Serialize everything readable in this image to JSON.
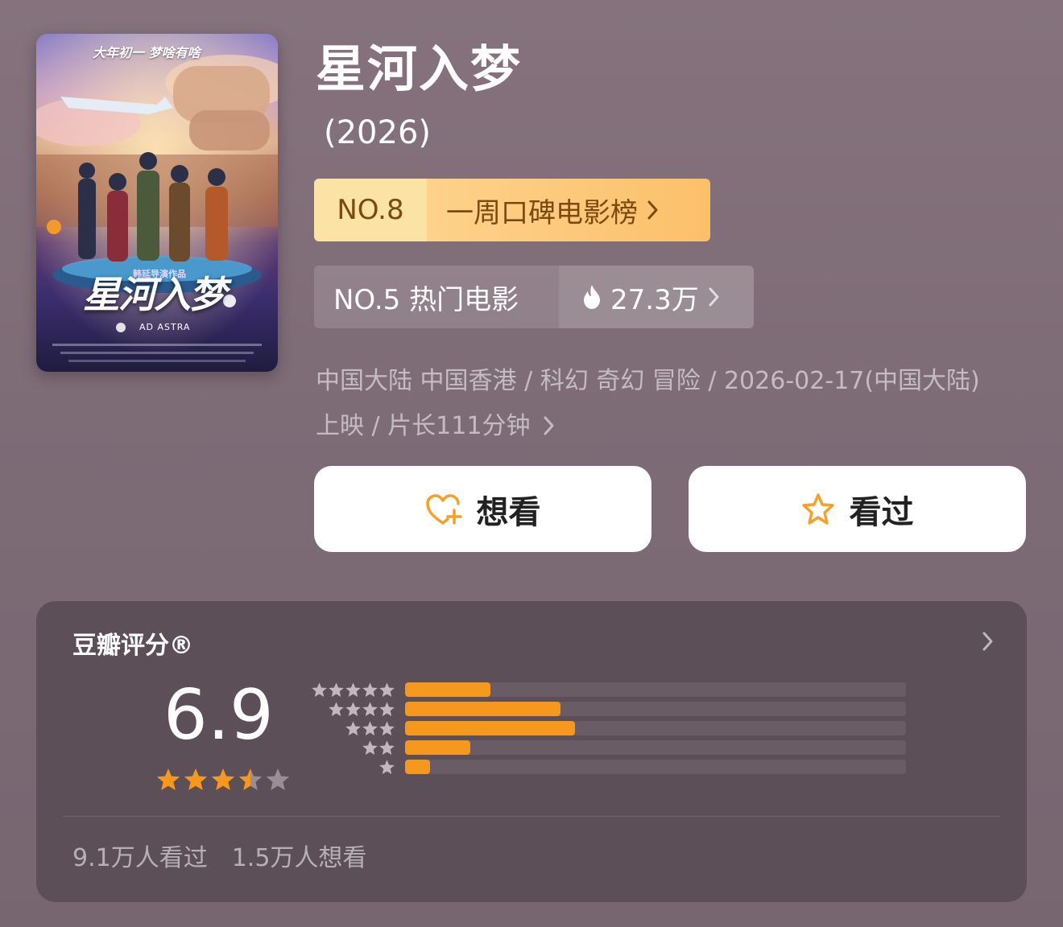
{
  "poster": {
    "tagline": "大年初一 梦啥有啥",
    "title": "星河入梦",
    "director": "韩延导演作品",
    "subtitle": "AD ASTRA"
  },
  "movie": {
    "title": "星河入梦",
    "year": "(2026)"
  },
  "ranks": {
    "weekly": {
      "number": "NO.8",
      "label": "一周口碑电影榜"
    },
    "hot": {
      "label": "NO.5 热门电影",
      "heat": "27.3万"
    }
  },
  "meta": {
    "text": "中国大陆 中国香港 / 科幻 奇幻 冒险 / 2026-02-17(中国大陆) 上映 / 片长111分钟"
  },
  "actions": {
    "want": "想看",
    "seen": "看过"
  },
  "rating": {
    "header": "豆瓣评分®",
    "score": "6.9",
    "stars": 3.5,
    "distribution": [
      {
        "stars": 5,
        "value": 0.17
      },
      {
        "stars": 4,
        "value": 0.31
      },
      {
        "stars": 3,
        "value": 0.34
      },
      {
        "stars": 2,
        "value": 0.13
      },
      {
        "stars": 1,
        "value": 0.05
      }
    ],
    "seen_count": "9.1万人看过",
    "want_count": "1.5万人想看"
  },
  "colors": {
    "accent_orange": "#f6981d",
    "gold_badge": "#fcc06a",
    "heart_icon": "#f2a12a",
    "star_empty": "#9a8d95"
  }
}
